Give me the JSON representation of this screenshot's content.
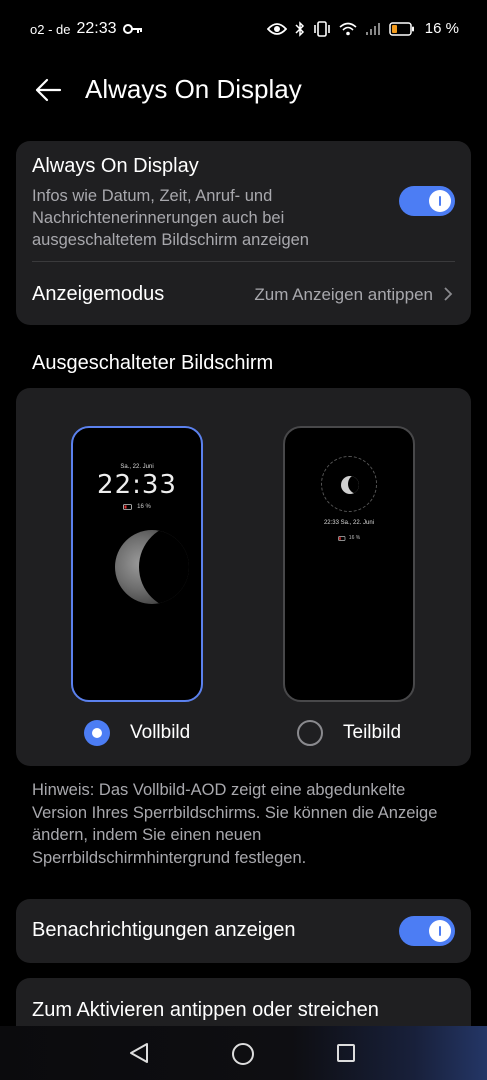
{
  "status_bar": {
    "carrier": "o2 - de",
    "time": "22:33",
    "battery_percent": "16 %",
    "icons": [
      "key-icon",
      "eye-icon",
      "bluetooth-icon",
      "vibrate-icon",
      "wifi-icon",
      "signal-icon",
      "battery-icon"
    ]
  },
  "header": {
    "title": "Always On Display",
    "back_icon": "arrow-left-icon"
  },
  "aod_card": {
    "title": "Always On Display",
    "description": "Infos wie Datum, Zeit, Anruf- und Nachrichtenerinnerungen auch bei ausgeschaltetem Bildschirm anzeigen",
    "toggle_on": true,
    "mode_label": "Anzeigemodus",
    "mode_value": "Zum Anzeigen antippen"
  },
  "screen_section": {
    "title": "Ausgeschalteter Bildschirm",
    "options": [
      {
        "label": "Vollbild",
        "selected": true,
        "preview": {
          "date": "Sa., 22. Juni",
          "time": "22:33",
          "battery": "16 %"
        }
      },
      {
        "label": "Teilbild",
        "selected": false,
        "preview": {
          "line": "22:33 Sa., 22. Juni",
          "battery": "16 %"
        }
      }
    ]
  },
  "note": "Hinweis: Das Vollbild-AOD zeigt eine abgedunkelte Version Ihres Sperrbildschirms. Sie können die Anzeige ändern, indem Sie einen neuen Sperrbildschirmhintergrund festlegen.",
  "notifications": {
    "label": "Benachrichtigungen anzeigen",
    "toggle_on": true
  },
  "tap_activate": {
    "label": "Zum Aktivieren antippen oder streichen"
  },
  "colors": {
    "accent": "#4c7df4",
    "card_bg": "#1f1f21",
    "secondary_text": "#a8a8ad"
  },
  "nav_bar": {
    "icons": [
      "nav-back-icon",
      "nav-home-icon",
      "nav-recent-icon"
    ]
  }
}
